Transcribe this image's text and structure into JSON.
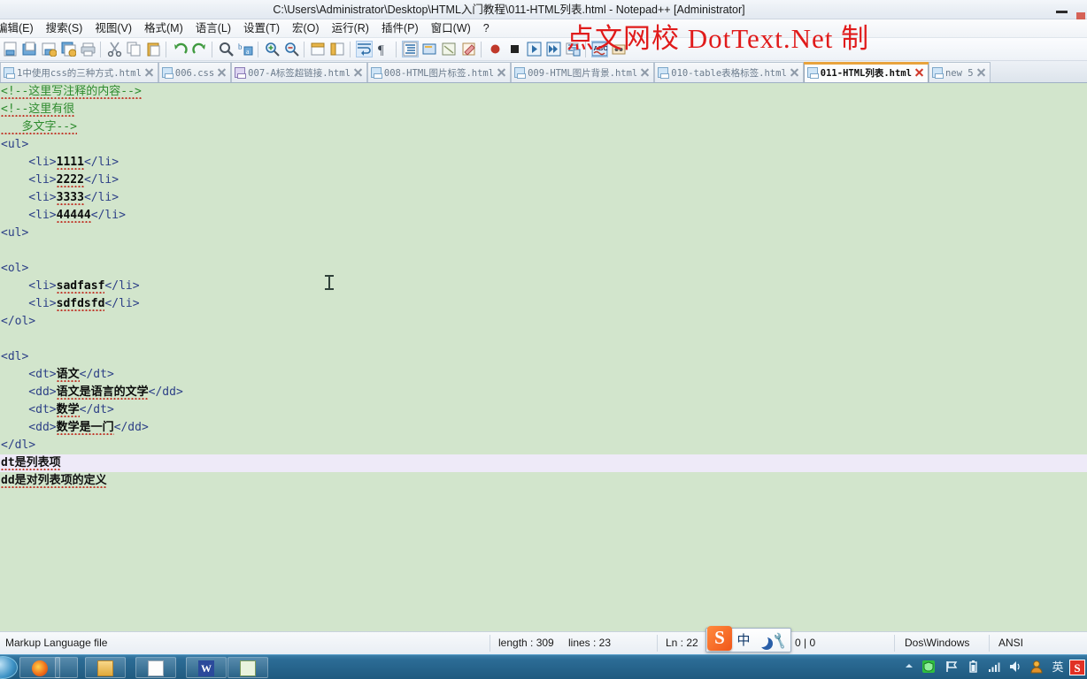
{
  "window": {
    "title": "C:\\Users\\Administrator\\Desktop\\HTML入门教程\\011-HTML列表.html - Notepad++ [Administrator]",
    "minimize_label": "–"
  },
  "watermark": {
    "text": "点文网校 DotText.Net 制"
  },
  "menu": {
    "items": [
      {
        "label": "编辑(E)"
      },
      {
        "label": "搜索(S)"
      },
      {
        "label": "视图(V)"
      },
      {
        "label": "格式(M)"
      },
      {
        "label": "语言(L)"
      },
      {
        "label": "设置(T)"
      },
      {
        "label": "宏(O)"
      },
      {
        "label": "运行(R)"
      },
      {
        "label": "插件(P)"
      },
      {
        "label": "窗口(W)"
      },
      {
        "label": "?"
      }
    ]
  },
  "toolbar": {
    "buttons": [
      {
        "name": "new-file-icon"
      },
      {
        "name": "open-file-icon"
      },
      {
        "name": "save-icon"
      },
      {
        "name": "save-all-icon"
      },
      {
        "name": "print-icon"
      },
      {
        "name": "separator"
      },
      {
        "name": "cut-icon"
      },
      {
        "name": "copy-icon"
      },
      {
        "name": "paste-icon"
      },
      {
        "name": "separator"
      },
      {
        "name": "undo-icon"
      },
      {
        "name": "redo-icon"
      },
      {
        "name": "separator"
      },
      {
        "name": "find-icon"
      },
      {
        "name": "replace-icon"
      },
      {
        "name": "separator"
      },
      {
        "name": "zoom-in-icon"
      },
      {
        "name": "zoom-out-icon"
      },
      {
        "name": "separator"
      },
      {
        "name": "sync-vertical-icon"
      },
      {
        "name": "sync-horizontal-icon"
      },
      {
        "name": "separator"
      },
      {
        "name": "word-wrap-icon"
      },
      {
        "name": "show-all-chars-icon"
      },
      {
        "name": "separator"
      },
      {
        "name": "indent-guide-icon"
      },
      {
        "name": "user-language-icon"
      },
      {
        "name": "show-doc-map-icon"
      },
      {
        "name": "function-list-icon"
      },
      {
        "name": "separator"
      },
      {
        "name": "record-macro-icon"
      },
      {
        "name": "stop-macro-icon"
      },
      {
        "name": "play-macro-icon"
      },
      {
        "name": "run-macro-multiple-icon"
      },
      {
        "name": "save-macro-icon"
      },
      {
        "name": "separator"
      },
      {
        "name": "spellcheck-icon"
      },
      {
        "name": "run-icon"
      }
    ]
  },
  "tabs": [
    {
      "label": "1中使用css的三种方式.html",
      "icon": "file-icon-blue",
      "active": false
    },
    {
      "label": "006.css",
      "icon": "file-icon-blue",
      "active": false
    },
    {
      "label": "007-A标签超链接.html",
      "icon": "file-icon-purple",
      "active": false
    },
    {
      "label": "008-HTML图片标签.html",
      "icon": "file-icon-blue",
      "active": false
    },
    {
      "label": "009-HTML图片背景.html",
      "icon": "file-icon-blue",
      "active": false
    },
    {
      "label": "010-table表格标签.html",
      "icon": "file-icon-blue",
      "active": false
    },
    {
      "label": "011-HTML列表.html",
      "icon": "file-icon-blue",
      "active": true
    },
    {
      "label": "new  5",
      "icon": "file-icon-blue",
      "active": false
    }
  ],
  "editor": {
    "lines": [
      {
        "text": "<!--这里写注释的内容-->",
        "style": "cmt",
        "current": false
      },
      {
        "text": "<!--这里有很",
        "style": "cmt",
        "current": false
      },
      {
        "text": "   多文字-->",
        "style": "cmt",
        "current": false
      },
      {
        "text": "<ul>",
        "style": "tag",
        "current": false
      },
      {
        "text": "    <li>1111</li>",
        "style": "tagtext",
        "current": false
      },
      {
        "text": "    <li>2222</li>",
        "style": "tagtext",
        "current": false
      },
      {
        "text": "    <li>3333</li>",
        "style": "tagtext",
        "current": false
      },
      {
        "text": "    <li>44444</li>",
        "style": "tagtext",
        "current": false
      },
      {
        "text": "<ul>",
        "style": "tag",
        "current": false
      },
      {
        "text": "",
        "style": "tag",
        "current": false
      },
      {
        "text": "<ol>",
        "style": "tag",
        "current": false
      },
      {
        "text": "    <li>sadfasf</li>",
        "style": "tagtext",
        "current": false
      },
      {
        "text": "    <li>sdfdsfd</li>",
        "style": "tagtext",
        "current": false
      },
      {
        "text": "</ol>",
        "style": "tag",
        "current": false
      },
      {
        "text": "",
        "style": "tag",
        "current": false
      },
      {
        "text": "<dl>",
        "style": "tag",
        "current": false
      },
      {
        "text": "    <dt>语文</dt>",
        "style": "tagtext",
        "current": false
      },
      {
        "text": "    <dd>语文是语言的文学</dd>",
        "style": "tagtext",
        "current": false
      },
      {
        "text": "    <dt>数学</dt>",
        "style": "tagtext",
        "current": false
      },
      {
        "text": "    <dd>数学是一门</dd>",
        "style": "tagtext",
        "current": false
      },
      {
        "text": "</dl>",
        "style": "tag",
        "current": false
      },
      {
        "text": "dt是列表项",
        "style": "plain",
        "current": true
      },
      {
        "text": "dd是对列表项的定义",
        "style": "plain",
        "current": false
      }
    ],
    "background_color": "#d2e5cc",
    "current_line_color": "#eeeaf8",
    "tag_color": "#2c3f86",
    "comment_color": "#2e8b2e"
  },
  "statusbar": {
    "file_type": "Markup Language file",
    "length": "length : 309",
    "lines": "lines : 23",
    "position": "Ln : 22",
    "selection": "0 | 0",
    "eol": "Dos\\Windows",
    "encoding": "ANSI"
  },
  "ime": {
    "logo": "S",
    "mode": "中",
    "moon_icon": "moon-icon",
    "tools_icon": "wrench-icon"
  },
  "taskbar": {
    "start": "start-orb",
    "buttons": [
      {
        "name": "firefox-icon"
      },
      {
        "name": "file-explorer-icon"
      },
      {
        "name": "notepad-icon"
      },
      {
        "name": "wps-writer-icon"
      },
      {
        "name": "notepadpp-icon"
      }
    ],
    "tray": [
      {
        "name": "show-hidden-icons-chevron",
        "glyph": "▲"
      },
      {
        "name": "security-shield-icon",
        "glyph": ""
      },
      {
        "name": "flag-icon",
        "glyph": "⚑"
      },
      {
        "name": "battery-icon",
        "glyph": ""
      },
      {
        "name": "network-signal-icon",
        "glyph": ""
      },
      {
        "name": "volume-icon",
        "glyph": "🔊"
      },
      {
        "name": "user-account-icon",
        "glyph": ""
      },
      {
        "name": "ime-language-indicator",
        "glyph": "英"
      },
      {
        "name": "sogou-tray-icon",
        "glyph": "S"
      }
    ]
  }
}
